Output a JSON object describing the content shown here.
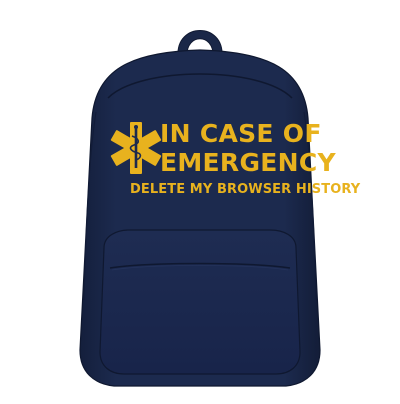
{
  "product": {
    "type": "backpack",
    "color": "#1c2a4e",
    "print_color": "#e8b21e"
  },
  "graphic": {
    "icon": "star-of-life-icon",
    "line1": "IN CASE OF",
    "line2": "EMERGENCY",
    "line3": "DELETE MY BROWSER HISTORY"
  }
}
